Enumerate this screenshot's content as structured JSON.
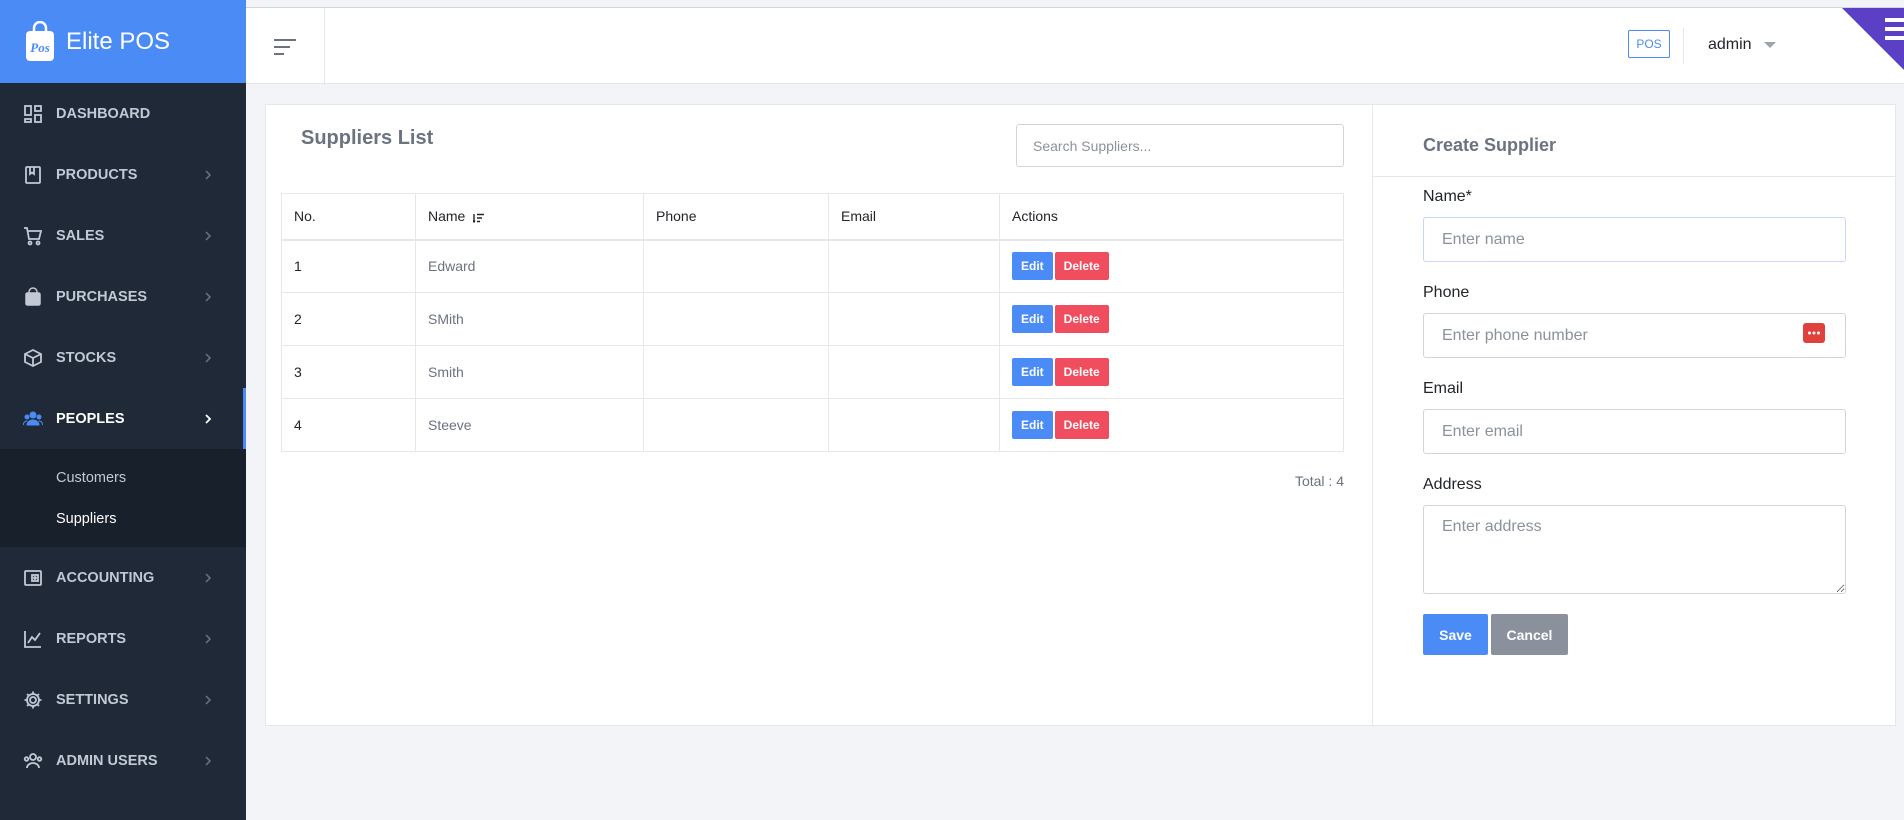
{
  "brand": {
    "name": "Elite POS"
  },
  "sidebar": {
    "items": [
      {
        "label": "DASHBOARD",
        "icon": "dashboard-icon"
      },
      {
        "label": "PRODUCTS",
        "icon": "book-icon"
      },
      {
        "label": "SALES",
        "icon": "cart-icon"
      },
      {
        "label": "PURCHASES",
        "icon": "bag-icon"
      },
      {
        "label": "STOCKS",
        "icon": "cube-icon"
      },
      {
        "label": "PEOPLES",
        "icon": "people-icon",
        "active": true
      },
      {
        "label": "ACCOUNTING",
        "icon": "wallet-icon"
      },
      {
        "label": "REPORTS",
        "icon": "chart-line-icon"
      },
      {
        "label": "SETTINGS",
        "icon": "gear-icon"
      },
      {
        "label": "ADMIN USERS",
        "icon": "admin-users-icon"
      }
    ],
    "submenu": [
      {
        "label": "Customers"
      },
      {
        "label": "Suppliers",
        "current": true
      }
    ]
  },
  "topbar": {
    "pos_label": "POS",
    "user_name": "admin"
  },
  "suppliers_list": {
    "title": "Suppliers List",
    "search_placeholder": "Search Suppliers...",
    "columns": [
      "No.",
      "Name",
      "Phone",
      "Email",
      "Actions"
    ],
    "rows": [
      {
        "no": "1",
        "name": "Edward",
        "phone": "",
        "email": ""
      },
      {
        "no": "2",
        "name": "SMith",
        "phone": "",
        "email": ""
      },
      {
        "no": "3",
        "name": "Smith",
        "phone": "",
        "email": ""
      },
      {
        "no": "4",
        "name": "Steeve",
        "phone": "",
        "email": ""
      }
    ],
    "edit_label": "Edit",
    "delete_label": "Delete",
    "total_text": "Total : 4"
  },
  "create_form": {
    "title": "Create Supplier",
    "name_label": "Name*",
    "name_placeholder": "Enter name",
    "phone_label": "Phone",
    "phone_placeholder": "Enter phone number",
    "email_label": "Email",
    "email_placeholder": "Enter email",
    "address_label": "Address",
    "address_placeholder": "Enter address",
    "save_label": "Save",
    "cancel_label": "Cancel"
  },
  "colors": {
    "accent": "#4b8bf6",
    "danger": "#f04e5e",
    "sidebar_bg": "#1f2937",
    "secondary": "#8a919c"
  }
}
